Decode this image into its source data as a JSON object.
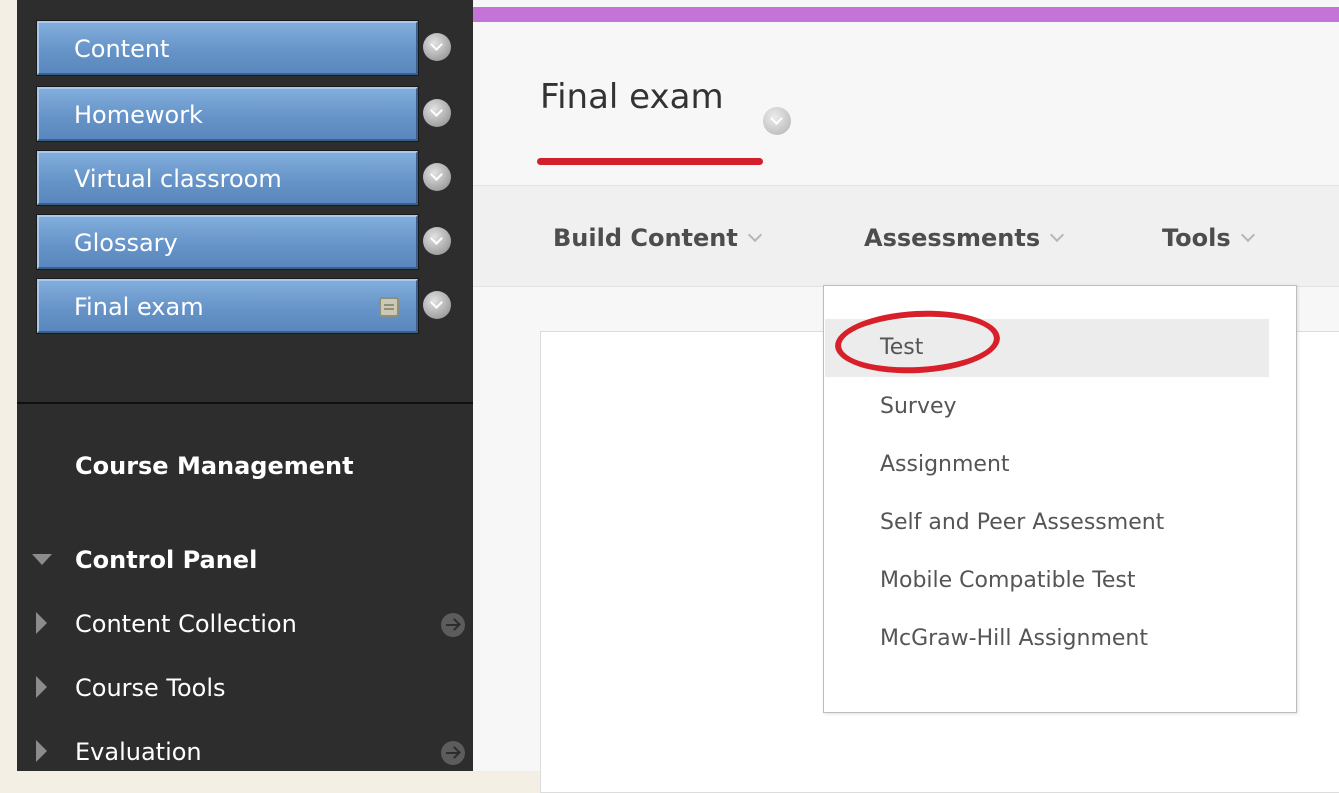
{
  "sidebar": {
    "menu_items": [
      {
        "label": "Content"
      },
      {
        "label": "Homework"
      },
      {
        "label": "Virtual classroom"
      },
      {
        "label": "Glossary"
      },
      {
        "label": "Final exam"
      }
    ],
    "course_management": {
      "heading": "Course Management",
      "control_panel": {
        "label": "Control Panel",
        "expanded": true,
        "items": [
          {
            "label": "Content Collection",
            "has_go_icon": true
          },
          {
            "label": "Course Tools",
            "has_go_icon": false
          },
          {
            "label": "Evaluation",
            "has_go_icon": true
          }
        ]
      }
    }
  },
  "main": {
    "title": "Final exam",
    "accent_color": "#c474d6",
    "annotation_color": "#d11f2b",
    "toolbar": [
      {
        "label": "Build Content"
      },
      {
        "label": "Assessments"
      },
      {
        "label": "Tools"
      }
    ],
    "assessments_menu": {
      "items": [
        {
          "label": "Test",
          "highlighted": true
        },
        {
          "label": "Survey"
        },
        {
          "label": "Assignment"
        },
        {
          "label": "Self and Peer Assessment"
        },
        {
          "label": "Mobile Compatible Test"
        },
        {
          "label": "McGraw-Hill Assignment"
        }
      ]
    }
  }
}
